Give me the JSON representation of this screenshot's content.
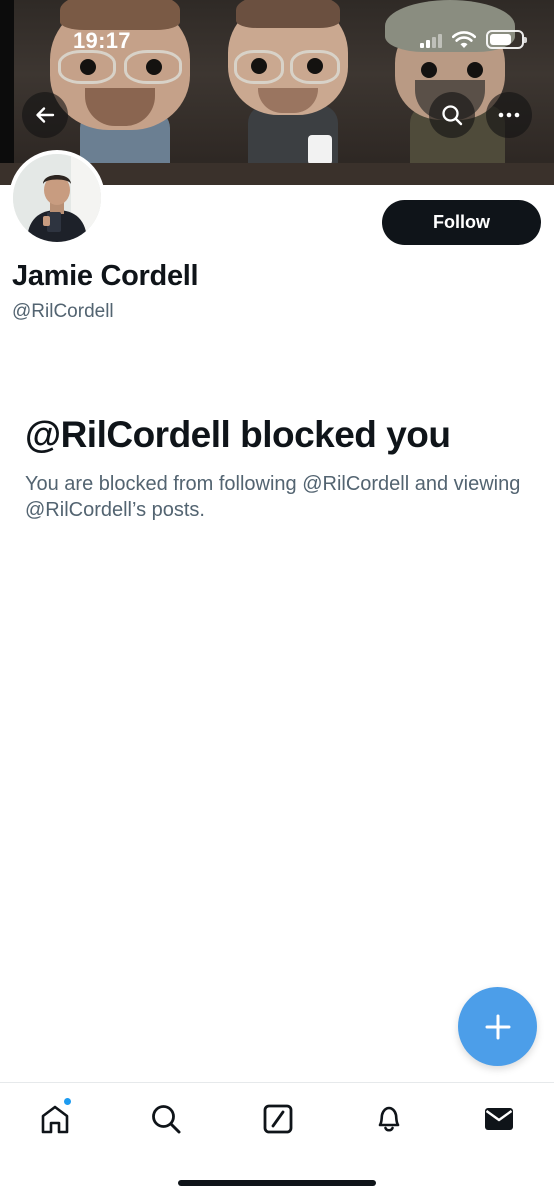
{
  "status_bar": {
    "time": "19:17"
  },
  "banner": {
    "back_icon": "arrow-left-icon",
    "search_icon": "search-icon",
    "more_icon": "more-horizontal-icon"
  },
  "profile": {
    "display_name": "Jamie Cordell",
    "handle": "@RilCordell",
    "follow_label": "Follow"
  },
  "blocked": {
    "title": "@RilCordell blocked you",
    "description": "You are blocked from following @RilCordell and viewing @RilCordell’s posts."
  },
  "fab": {
    "icon": "plus-icon"
  },
  "tabbar": {
    "items": [
      {
        "name": "home",
        "icon": "home-icon",
        "has_notification_dot": true
      },
      {
        "name": "search",
        "icon": "search-icon"
      },
      {
        "name": "compose",
        "icon": "compose-icon"
      },
      {
        "name": "notifications",
        "icon": "bell-icon"
      },
      {
        "name": "messages",
        "icon": "envelope-icon"
      }
    ]
  },
  "colors": {
    "accent": "#1d9bf0",
    "fab": "#4c9ee9",
    "text_primary": "#0f1419",
    "text_secondary": "#536471"
  }
}
